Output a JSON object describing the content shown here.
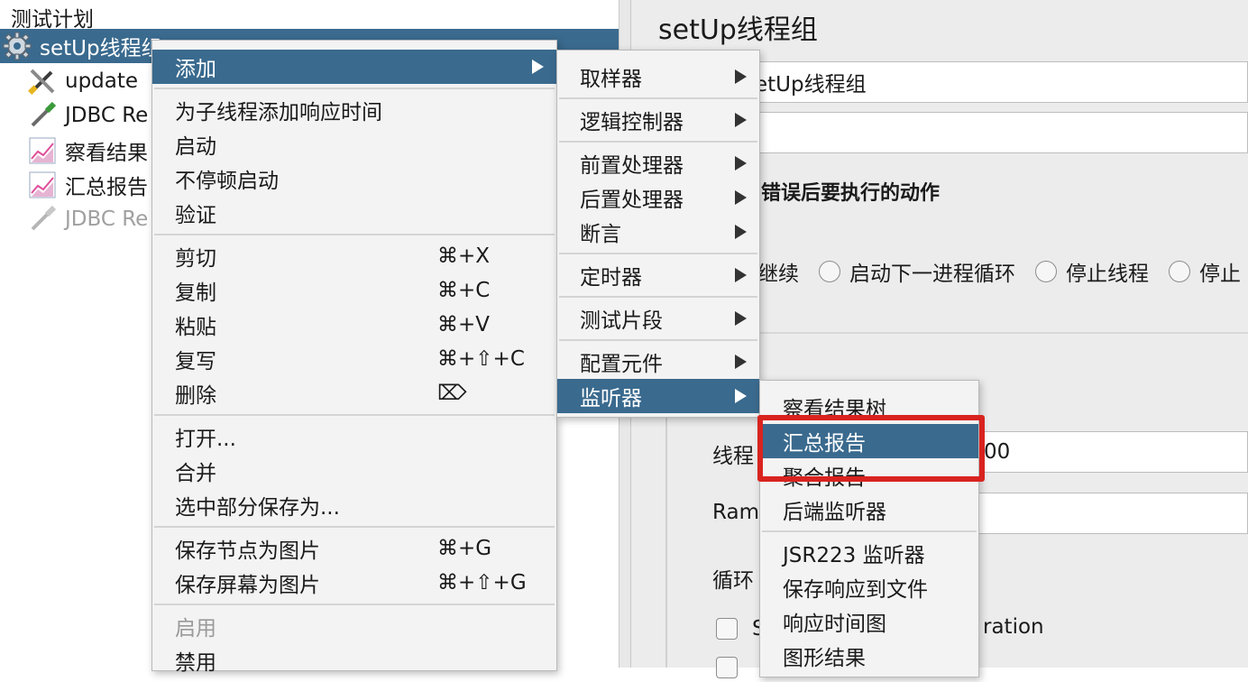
{
  "tree": {
    "root": "测试计划",
    "items": [
      {
        "label": "setUp线程组",
        "icon": "gear-icon",
        "state": "selected"
      },
      {
        "label": "update",
        "icon": "tools-icon",
        "state": "normal"
      },
      {
        "label": "JDBC Re",
        "icon": "pipette-icon",
        "state": "normal"
      },
      {
        "label": "察看结果",
        "icon": "graph-icon",
        "state": "normal"
      },
      {
        "label": "汇总报告",
        "icon": "graph-icon",
        "state": "normal"
      },
      {
        "label": "JDBC Re",
        "icon": "pipette-icon",
        "state": "disabled"
      }
    ]
  },
  "panel": {
    "title": "setUp线程组",
    "name_value": "etUp线程组",
    "error_action_label": "错误后要执行的动作",
    "radio_options": [
      "继续",
      "启动下一进程循环",
      "停止线程",
      "停止"
    ],
    "threads_label": "线程",
    "threads_value": "00",
    "ramp_label": "Ram",
    "loop_label": "循环",
    "checkbox1_visible_text": "S",
    "checkbox1_tail": "ration"
  },
  "context_menu": {
    "items": [
      {
        "label": "添加",
        "shortcut": "",
        "submenu": true,
        "highlight": true
      },
      {
        "label": "为子线程添加响应时间",
        "shortcut": ""
      },
      {
        "label": "启动",
        "shortcut": ""
      },
      {
        "label": "不停顿启动",
        "shortcut": ""
      },
      {
        "label": "验证",
        "shortcut": ""
      },
      {
        "label": "剪切",
        "shortcut": "⌘+X"
      },
      {
        "label": "复制",
        "shortcut": "⌘+C"
      },
      {
        "label": "粘贴",
        "shortcut": "⌘+V"
      },
      {
        "label": "复写",
        "shortcut": "⌘+⇧+C"
      },
      {
        "label": "删除",
        "shortcut": "⌦"
      },
      {
        "label": "打开...",
        "shortcut": ""
      },
      {
        "label": "合并",
        "shortcut": ""
      },
      {
        "label": "选中部分保存为...",
        "shortcut": ""
      },
      {
        "label": "保存节点为图片",
        "shortcut": "⌘+G"
      },
      {
        "label": "保存屏幕为图片",
        "shortcut": "⌘+⇧+G"
      },
      {
        "label": "启用",
        "shortcut": "",
        "disabled": true
      },
      {
        "label": "禁用",
        "shortcut": ""
      }
    ]
  },
  "add_submenu": {
    "items": [
      {
        "label": "取样器"
      },
      {
        "label": "逻辑控制器"
      },
      {
        "label": "前置处理器"
      },
      {
        "label": "后置处理器"
      },
      {
        "label": "断言"
      },
      {
        "label": "定时器"
      },
      {
        "label": "测试片段"
      },
      {
        "label": "配置元件"
      },
      {
        "label": "监听器",
        "highlight": true
      }
    ]
  },
  "listener_submenu": {
    "items": [
      {
        "label": "察看结果树"
      },
      {
        "label": "汇总报告",
        "highlight": true
      },
      {
        "label": "聚合报告"
      },
      {
        "label": "后端监听器"
      },
      {
        "label": "JSR223 监听器"
      },
      {
        "label": "保存响应到文件"
      },
      {
        "label": "响应时间图"
      },
      {
        "label": "图形结果"
      }
    ]
  },
  "colors": {
    "selection": "#3a6a8e",
    "annotation_box": "#d9231f"
  }
}
